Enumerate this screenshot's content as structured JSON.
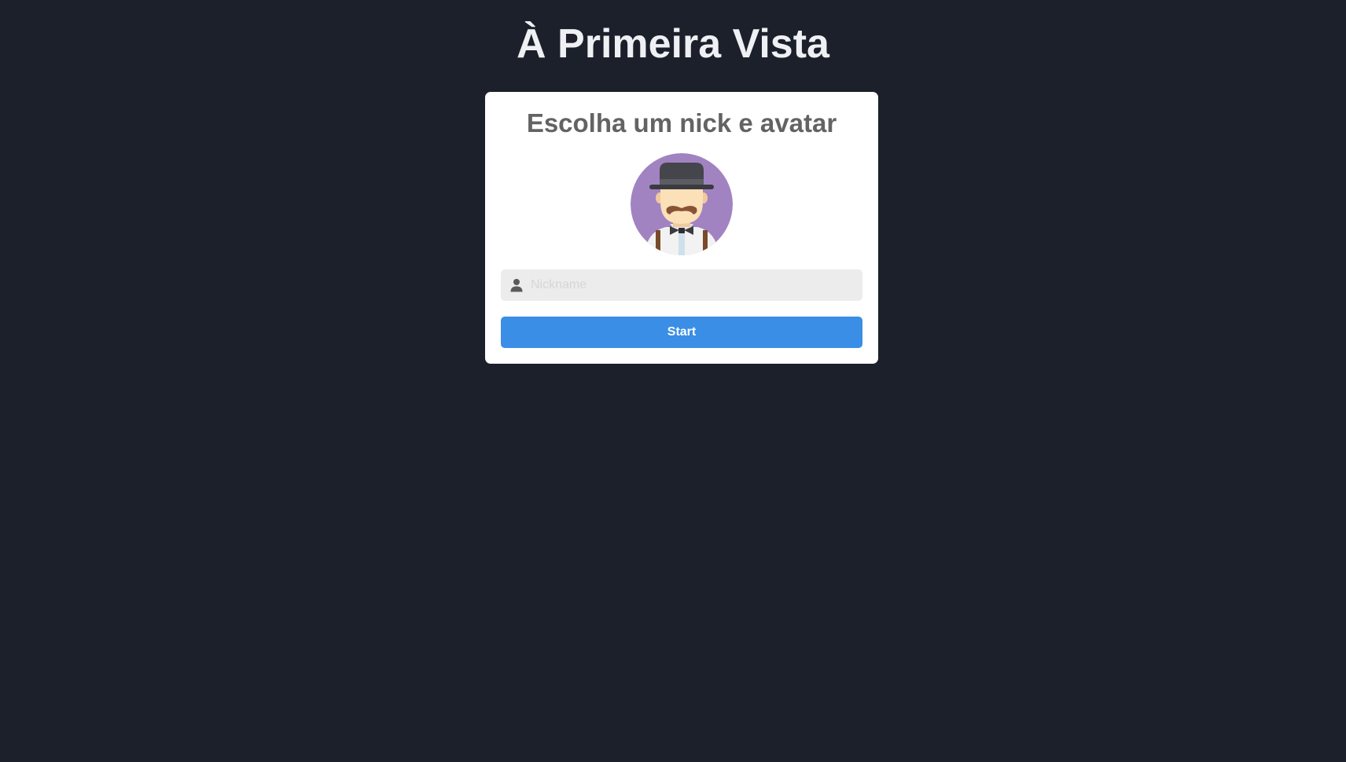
{
  "app": {
    "title": "À Primeira Vista"
  },
  "card": {
    "title": "Escolha um nick e avatar",
    "avatar_icon": "mustache-gentleman-avatar-icon",
    "nick_input": {
      "placeholder": "Nickname",
      "value": "",
      "icon": "user-icon"
    },
    "start_label": "Start"
  },
  "colors": {
    "background": "#1b202b",
    "card": "#ffffff",
    "button": "#3a8ee6",
    "avatar_bg": "#a183c2"
  }
}
